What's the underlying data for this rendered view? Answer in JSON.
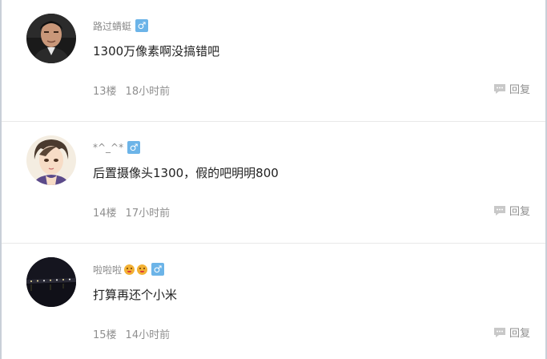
{
  "reply_label": "回复",
  "gender_symbol": "♂",
  "colors": {
    "gender_badge": "#6cb4e8",
    "meta_text": "#8f8f8f",
    "content_text": "#222222"
  },
  "posts": [
    {
      "username": "路过蜻蜓",
      "emoji_count": 0,
      "content": "1300万像素啊没搞错吧",
      "floor": "13楼",
      "time": "18小时前",
      "avatar": "man-portrait"
    },
    {
      "username": "*^_^*",
      "emoji_count": 0,
      "content": "后置摄像头1300，假的吧明明800",
      "floor": "14楼",
      "time": "17小时前",
      "avatar": "anime-girl"
    },
    {
      "username": "啦啦啦",
      "emoji_count": 2,
      "content": "打算再还个小米",
      "floor": "15楼",
      "time": "14小时前",
      "avatar": "night-bridge"
    }
  ]
}
